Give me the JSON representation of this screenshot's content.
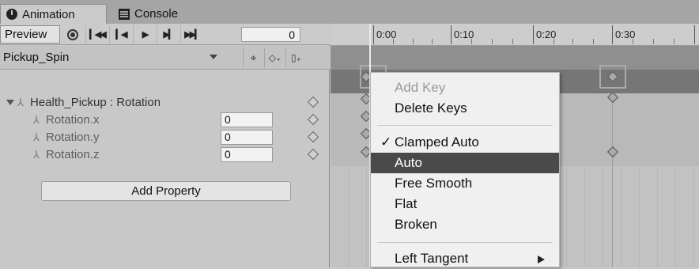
{
  "tabs": [
    {
      "label": "Animation",
      "icon": "clock-icon"
    },
    {
      "label": "Console",
      "icon": "console-icon"
    }
  ],
  "toolbar": {
    "preview_label": "Preview",
    "frame_value": "0",
    "buttons": [
      "skip-to-start",
      "previous-key",
      "play",
      "next-key",
      "skip-to-end"
    ]
  },
  "clip": {
    "name": "Pickup_Spin"
  },
  "properties": {
    "header": "Health_Pickup : Rotation",
    "rows": [
      {
        "label": "Rotation.x",
        "value": "0"
      },
      {
        "label": "Rotation.y",
        "value": "0"
      },
      {
        "label": "Rotation.z",
        "value": "0"
      }
    ],
    "add_label": "Add Property"
  },
  "ruler": {
    "labels": [
      "0:00",
      "0:10",
      "0:20",
      "0:30"
    ]
  },
  "menu": {
    "items": [
      {
        "label": "Add Key",
        "disabled": true
      },
      {
        "label": "Delete Keys"
      },
      {
        "label": "Clamped Auto",
        "checked": true
      },
      {
        "label": "Auto",
        "highlighted": true
      },
      {
        "label": "Free Smooth"
      },
      {
        "label": "Flat"
      },
      {
        "label": "Broken"
      },
      {
        "label": "Left Tangent",
        "submenu": true
      }
    ],
    "check_glyph": "✓"
  },
  "colors": {
    "menu_highlight": "#4a4a4a",
    "panel_bg": "#c8c8c8"
  }
}
